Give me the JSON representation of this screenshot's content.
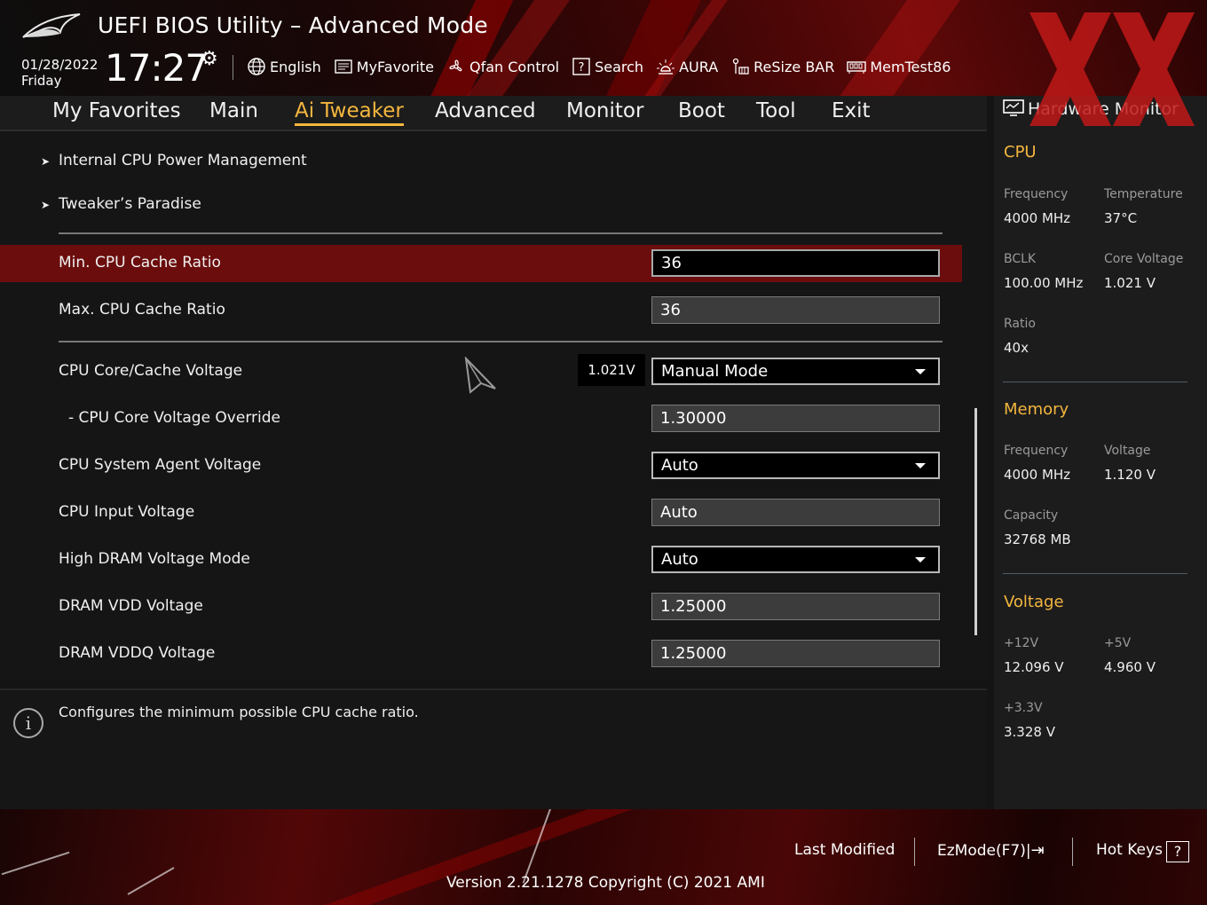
{
  "header": {
    "title": "UEFI BIOS Utility – Advanced Mode",
    "date": "01/28/2022",
    "day": "Friday",
    "time": "17:27",
    "toolbar": {
      "language": "English",
      "my_favorite": "MyFavorite",
      "qfan": "Qfan Control",
      "search": "Search",
      "aura": "AURA",
      "resize_bar": "ReSize BAR",
      "memtest": "MemTest86"
    }
  },
  "tabs": [
    {
      "label": "My Favorites"
    },
    {
      "label": "Main"
    },
    {
      "label": "Ai Tweaker",
      "active": true
    },
    {
      "label": "Advanced"
    },
    {
      "label": "Monitor"
    },
    {
      "label": "Boot"
    },
    {
      "label": "Tool"
    },
    {
      "label": "Exit"
    }
  ],
  "submenus": [
    {
      "label": "Internal CPU Power Management"
    },
    {
      "label": "Tweaker’s Paradise"
    }
  ],
  "settings": [
    {
      "label": "Min. CPU Cache Ratio",
      "value": "36",
      "control": "input",
      "selected": true
    },
    {
      "label": "Max. CPU Cache Ratio",
      "value": "36",
      "control": "input"
    },
    {
      "label": "CPU Core/Cache Voltage",
      "value": "Manual Mode",
      "control": "dropdown",
      "reading": "1.021V"
    },
    {
      "label": "- CPU Core Voltage Override",
      "value": "1.30000",
      "control": "input"
    },
    {
      "label": "CPU System Agent Voltage",
      "value": "Auto",
      "control": "dropdown"
    },
    {
      "label": "CPU Input Voltage",
      "value": "Auto",
      "control": "input"
    },
    {
      "label": "High DRAM Voltage Mode",
      "value": "Auto",
      "control": "dropdown"
    },
    {
      "label": "DRAM VDD Voltage",
      "value": "1.25000",
      "control": "input"
    },
    {
      "label": "DRAM VDDQ Voltage",
      "value": "1.25000",
      "control": "input"
    }
  ],
  "help_text": "Configures the minimum possible CPU cache ratio.",
  "hardware_monitor": {
    "title": "Hardware Monitor",
    "cpu": {
      "heading": "CPU",
      "frequency_label": "Frequency",
      "frequency": "4000 MHz",
      "temperature_label": "Temperature",
      "temperature": "37°C",
      "bclk_label": "BCLK",
      "bclk": "100.00 MHz",
      "core_voltage_label": "Core Voltage",
      "core_voltage": "1.021 V",
      "ratio_label": "Ratio",
      "ratio": "40x"
    },
    "memory": {
      "heading": "Memory",
      "frequency_label": "Frequency",
      "frequency": "4000 MHz",
      "voltage_label": "Voltage",
      "voltage": "1.120 V",
      "capacity_label": "Capacity",
      "capacity": "32768 MB"
    },
    "voltage": {
      "heading": "Voltage",
      "v12_label": "+12V",
      "v12": "12.096 V",
      "v5_label": "+5V",
      "v5": "4.960 V",
      "v33_label": "+3.3V",
      "v33": "3.328 V"
    }
  },
  "footer": {
    "last_modified": "Last Modified",
    "ezmode": "EzMode(F7)|",
    "hot_keys": "Hot Keys",
    "hot_keys_symbol": "?",
    "version": "Version 2.21.1278 Copyright (C) 2021 AMI"
  },
  "colors": {
    "accent": "#f4b63e",
    "selected_row": "#6b0d0d",
    "brand_red": "#c01818"
  }
}
